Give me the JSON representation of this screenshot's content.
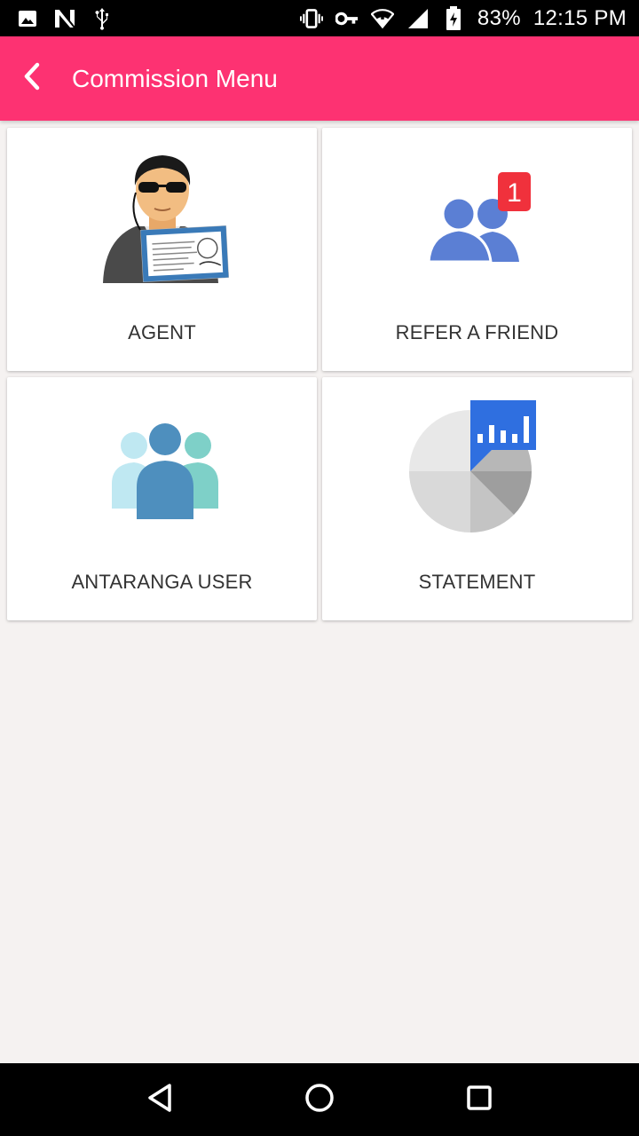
{
  "status_bar": {
    "battery_percent": "83%",
    "time": "12:15 PM",
    "left_icons": [
      "image-icon",
      "n-notification-icon",
      "usb-icon"
    ],
    "right_icons": [
      "vibrate-icon",
      "vpn-key-icon",
      "wifi-icon",
      "cell-signal-icon",
      "battery-charging-icon"
    ]
  },
  "app_bar": {
    "title": "Commission Menu",
    "background": "#fd3272",
    "back_icon": "chevron-left-icon"
  },
  "menu": {
    "tiles": [
      {
        "label": "AGENT",
        "icon": "agent-icon"
      },
      {
        "label": "REFER A FRIEND",
        "icon": "refer-friend-icon",
        "badge": "1"
      },
      {
        "label": "ANTARANGA USER",
        "icon": "users-group-icon"
      },
      {
        "label": "STATEMENT",
        "icon": "statement-chart-icon"
      }
    ]
  },
  "nav_bar": {
    "buttons": [
      "back-triangle-icon",
      "home-circle-icon",
      "recents-square-icon"
    ]
  }
}
